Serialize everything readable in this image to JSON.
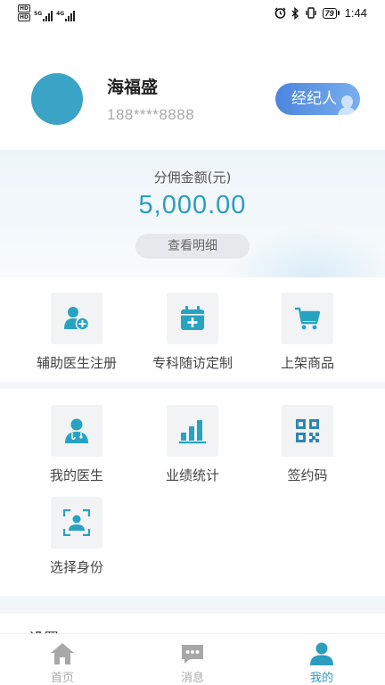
{
  "status_bar": {
    "hd_top": "HD",
    "hd_bottom": "HD",
    "net_1": "5G",
    "net_2": "4G",
    "battery": "79",
    "time": "1:44"
  },
  "profile": {
    "name": "海福盛",
    "phone": "188****8888",
    "role": "经纪人"
  },
  "commission": {
    "label": "分佣金额(元)",
    "amount": "5,000.00",
    "detail_button": "查看明细"
  },
  "quick_actions": [
    {
      "label": "辅助医生注册",
      "icon": "doctor-add-icon"
    },
    {
      "label": "专科随访定制",
      "icon": "calendar-add-icon"
    },
    {
      "label": "上架商品",
      "icon": "cart-icon"
    }
  ],
  "menu": [
    {
      "label": "我的医生",
      "icon": "doctor-icon"
    },
    {
      "label": "业绩统计",
      "icon": "bar-chart-icon"
    },
    {
      "label": "签约码",
      "icon": "qr-code-icon"
    },
    {
      "label": "选择身份",
      "icon": "identity-scan-icon"
    }
  ],
  "settings": {
    "label": "设置"
  },
  "bottom_nav": [
    {
      "label": "首页",
      "icon": "home-icon",
      "active": false
    },
    {
      "label": "消息",
      "icon": "message-icon",
      "active": false
    },
    {
      "label": "我的",
      "icon": "user-icon",
      "active": true
    }
  ],
  "colors": {
    "accent": "#2d9dbd",
    "avatar": "#3aa3c6",
    "role_badge": "#5a94e2",
    "icon_teal": "#27a3c2",
    "nav_inactive": "#a8a8a8"
  }
}
